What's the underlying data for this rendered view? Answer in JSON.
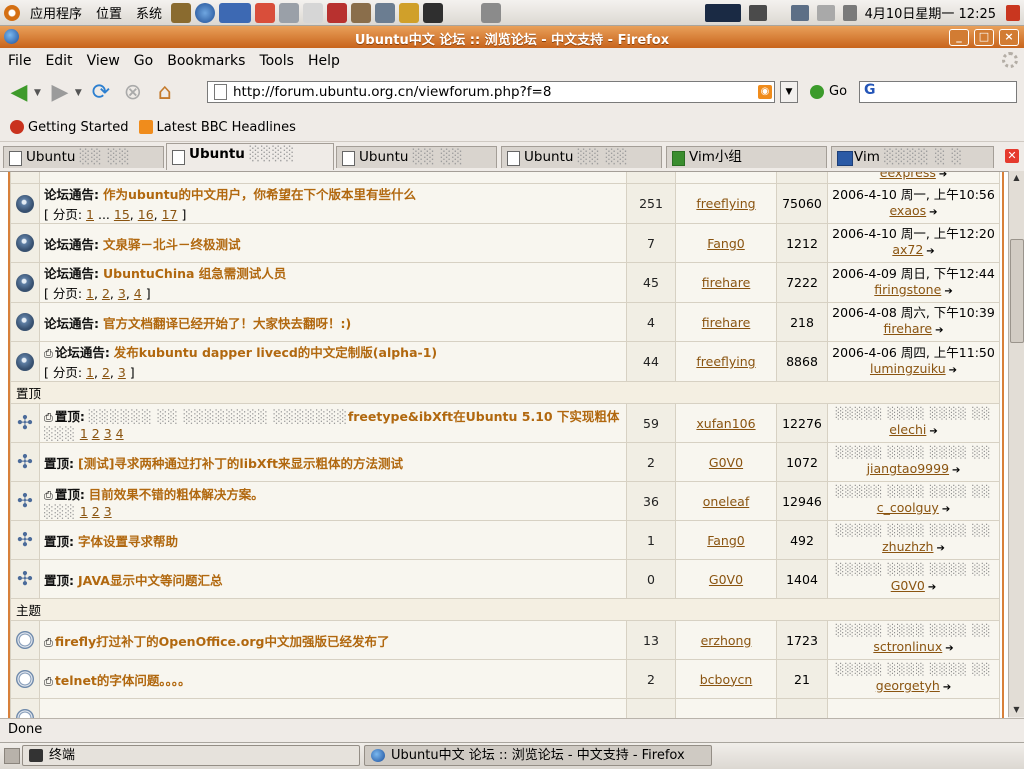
{
  "top_panel": {
    "menus": [
      "应用程序",
      "位置",
      "系统"
    ],
    "clock": "4月10日星期一 12:25"
  },
  "window": {
    "title": "Ubuntu中文 论坛 :: 浏览论坛 - 中文支持 - Firefox",
    "minimize": "_",
    "maximize": "□",
    "close": "×"
  },
  "menubar": [
    "File",
    "Edit",
    "View",
    "Go",
    "Bookmarks",
    "Tools",
    "Help"
  ],
  "navbar": {
    "url": "http://forum.ubuntu.org.cn/viewforum.php?f=8",
    "go_label": "Go",
    "search_placeholder": ""
  },
  "bookmarks": [
    "Getting Started",
    "Latest BBC Headlines"
  ],
  "tabs": [
    {
      "label": "Ubuntu",
      "active": false
    },
    {
      "label": "Ubuntu",
      "active": true
    },
    {
      "label": "Ubuntu",
      "active": false
    },
    {
      "label": "Ubuntu",
      "active": false
    },
    {
      "label": "Vim小组",
      "active": false
    },
    {
      "label": "Vim",
      "active": false
    }
  ],
  "forum": {
    "top_partial_last": "eexpress",
    "announcements": [
      {
        "prefix": "论坛通告:",
        "title": "作为ubuntu的中文用户，你希望在下个版本里有些什么",
        "pages_label": "[ 分页:",
        "pages": [
          "1",
          "...",
          "15",
          "16",
          "17"
        ],
        "pages_end": "]",
        "replies": "251",
        "author": "freeflying",
        "views": "75060",
        "last_time": "2006-4-10 周一, 上午10:56",
        "last_user": "exaos"
      },
      {
        "prefix": "论坛通告:",
        "title": "文泉驿－北斗－终极测试",
        "pages_label": "",
        "pages": [],
        "pages_end": "",
        "replies": "7",
        "author": "Fang0",
        "views": "1212",
        "last_time": "2006-4-10 周一, 上午12:20",
        "last_user": "ax72"
      },
      {
        "prefix": "论坛通告:",
        "title": "UbuntuChina 组急需测试人员",
        "pages_label": "[ 分页:",
        "pages": [
          "1",
          "2",
          "3",
          "4"
        ],
        "pages_end": "]",
        "replies": "45",
        "author": "firehare",
        "views": "7222",
        "last_time": "2006-4-09 周日, 下午12:44",
        "last_user": "firingstone"
      },
      {
        "prefix": "论坛通告:",
        "title": "官方文档翻译已经开始了！大家快去翻呀！:)",
        "pages_label": "",
        "pages": [],
        "pages_end": "",
        "replies": "4",
        "author": "firehare",
        "views": "218",
        "last_time": "2006-4-08 周六, 下午10:39",
        "last_user": "firehare"
      },
      {
        "prefix": "论坛通告:",
        "title": "发布kubuntu dapper livecd的中文定制版(alpha-1)",
        "pages_label": "[ 分页:",
        "pages": [
          "1",
          "2",
          "3"
        ],
        "pages_end": "]",
        "replies": "44",
        "author": "freeflying",
        "views": "8868",
        "last_time": "2006-4-06 周四, 上午11:50",
        "last_user": "lumingzuiku"
      }
    ],
    "sticky_header": "置顶",
    "stickies": [
      {
        "prefix": "置顶:",
        "title": "freetype&ibXft在Ubuntu 5.10 下实现粗体",
        "pages": [
          "1",
          "2",
          "3",
          "4"
        ],
        "replies": "59",
        "author": "xufan106",
        "views": "12276",
        "last_user": "elechi"
      },
      {
        "prefix": "置顶:",
        "title": "[测试]寻求两种通过打补丁的libXft来显示粗体的方法测试",
        "pages": [],
        "replies": "2",
        "author": "G0V0",
        "views": "1072",
        "last_user": "jiangtao9999"
      },
      {
        "prefix": "置顶:",
        "title": "目前效果不错的粗体解决方案。",
        "pages": [
          "1",
          "2",
          "3"
        ],
        "replies": "36",
        "author": "oneleaf",
        "views": "12946",
        "last_user": "c_coolguy"
      },
      {
        "prefix": "置顶:",
        "title": "字体设置寻求帮助",
        "pages": [],
        "replies": "1",
        "author": "Fang0",
        "views": "492",
        "last_user": "zhuzhzh"
      },
      {
        "prefix": "置顶:",
        "title": "JAVA显示中文等问题汇总",
        "pages": [],
        "replies": "0",
        "author": "G0V0",
        "views": "1404",
        "last_user": "G0V0"
      }
    ],
    "topics_header": "主题",
    "topics": [
      {
        "title": "firefly打过补丁的OpenOffice.org中文加强版已经发布了",
        "replies": "13",
        "author": "erzhong",
        "views": "1723",
        "last_user": "sctronlinux"
      },
      {
        "title": "telnet的字体问题。。。。",
        "replies": "2",
        "author": "bcboycn",
        "views": "21",
        "last_user": "georgetyh"
      }
    ]
  },
  "status": "Done",
  "taskbar": [
    {
      "label": "终端",
      "active": false
    },
    {
      "label": "Ubuntu中文 论坛 :: 浏览论坛 - 中文支持 - Firefox",
      "active": true
    }
  ]
}
